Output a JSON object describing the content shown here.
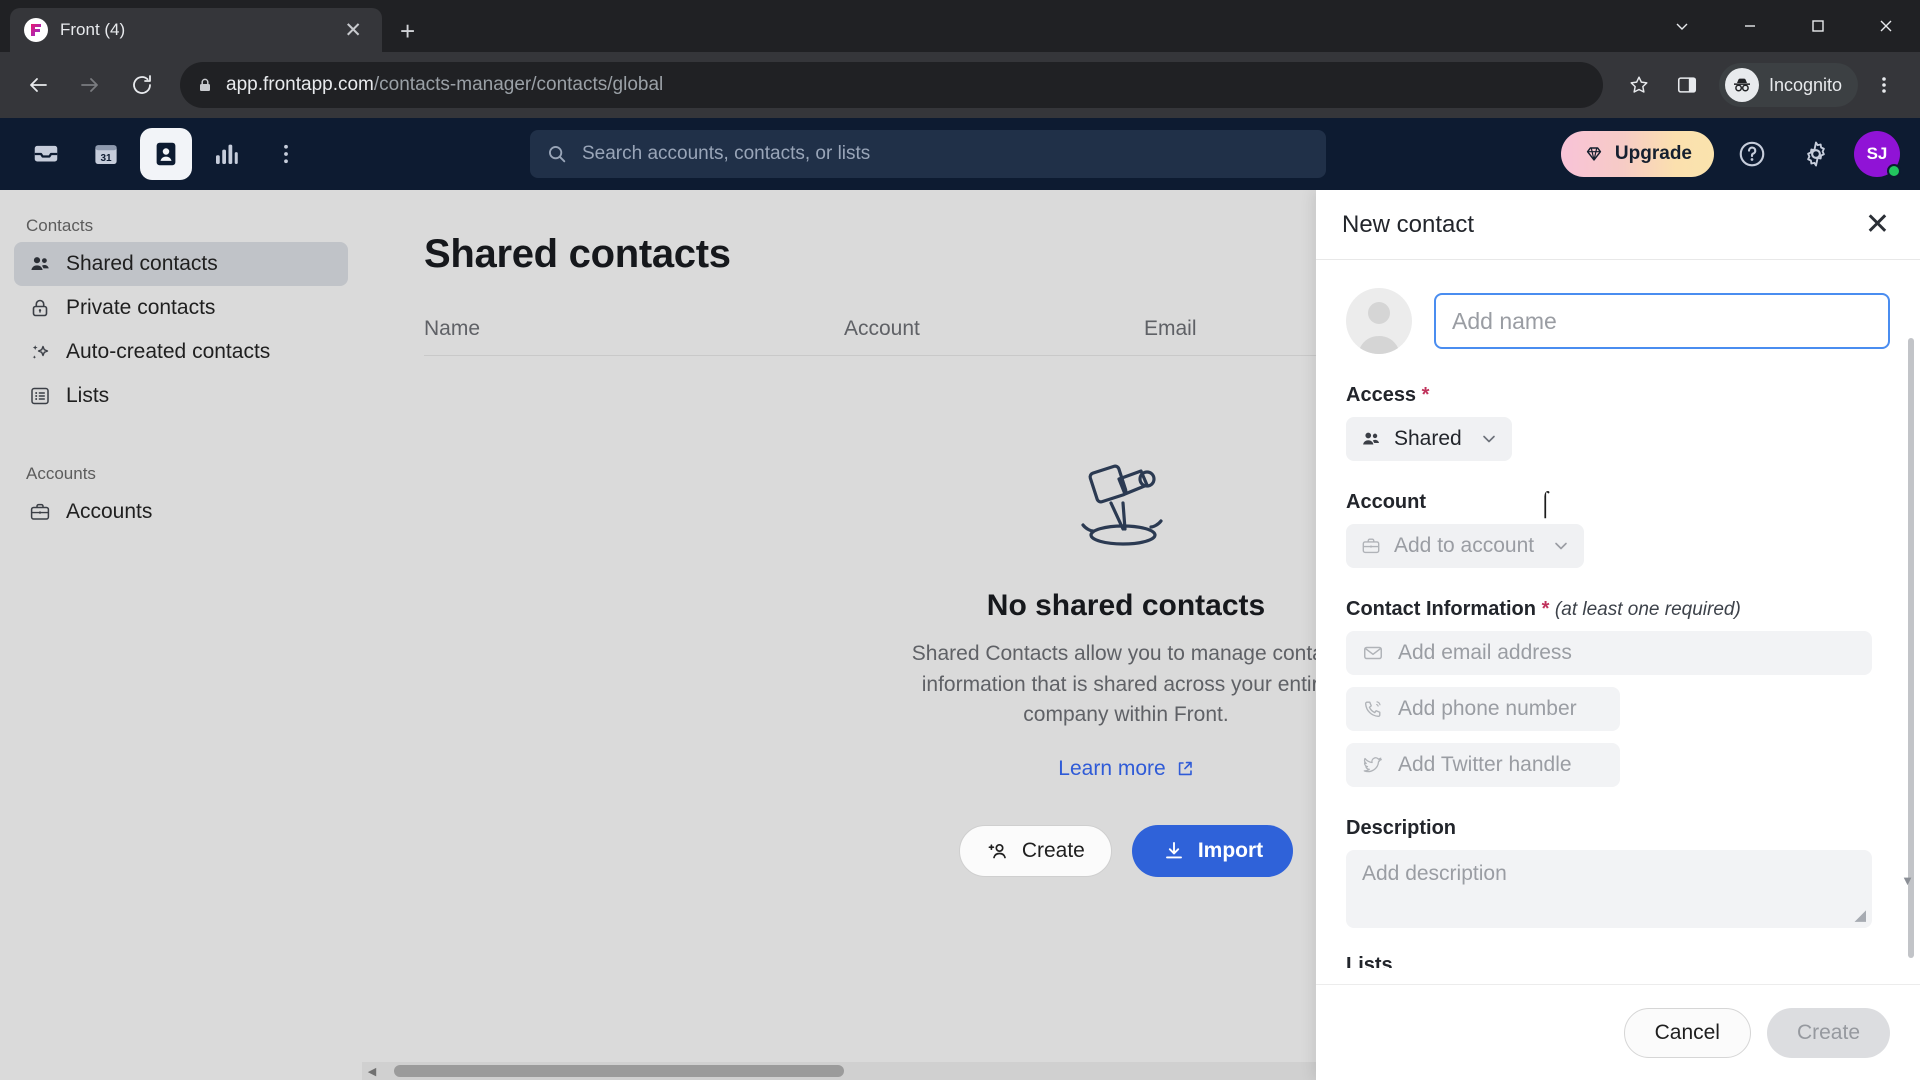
{
  "browser": {
    "tab": {
      "title": "Front (4)",
      "favicon_icon": "front-logo-icon",
      "close_icon": "close-icon"
    },
    "new_tab_label": "+",
    "window_controls": {
      "minimize": "–",
      "maximize": "□",
      "close": "✕",
      "chevron": "⌄"
    },
    "back_icon": "back-arrow-icon",
    "forward_icon": "forward-arrow-icon",
    "reload_icon": "reload-icon",
    "lock_icon": "lock-icon",
    "url_domain": "app.frontapp.com",
    "url_path": "/contacts-manager/contacts/global",
    "bookmark_icon": "star-icon",
    "sidepanel_icon": "side-panel-icon",
    "incognito_label": "Incognito",
    "menu_icon": "three-dot-menu-icon"
  },
  "app_topbar": {
    "nav": [
      {
        "name": "inbox",
        "icon": "inbox-icon",
        "active": false
      },
      {
        "name": "calendar",
        "icon": "calendar-31-icon",
        "active": false
      },
      {
        "name": "contacts",
        "icon": "contact-card-icon",
        "active": true
      },
      {
        "name": "analytics",
        "icon": "bar-chart-icon",
        "active": false
      },
      {
        "name": "more",
        "icon": "three-dot-vertical-icon",
        "active": false
      }
    ],
    "search_placeholder": "Search accounts, contacts, or lists",
    "search_icon": "search-icon",
    "upgrade_label": "Upgrade",
    "upgrade_icon": "diamond-icon",
    "help_icon": "question-circle-icon",
    "settings_icon": "gear-icon",
    "avatar_initials": "SJ"
  },
  "sidebar": {
    "groups": [
      {
        "label": "Contacts",
        "items": [
          {
            "label": "Shared contacts",
            "icon": "people-icon",
            "active": true
          },
          {
            "label": "Private contacts",
            "icon": "lock-icon",
            "active": false
          },
          {
            "label": "Auto-created contacts",
            "icon": "sparkle-icon",
            "active": false
          },
          {
            "label": "Lists",
            "icon": "list-icon",
            "active": false
          }
        ]
      },
      {
        "label": "Accounts",
        "items": [
          {
            "label": "Accounts",
            "icon": "briefcase-icon",
            "active": false
          }
        ]
      }
    ]
  },
  "main": {
    "page_title": "Shared contacts",
    "columns": [
      "Name",
      "Account",
      "Email"
    ],
    "empty_state": {
      "illustration": "telescope-icon",
      "title": "No shared contacts",
      "description": "Shared Contacts allow you to manage contact information that is shared across your entire company within Front.",
      "learn_more_label": "Learn more",
      "learn_more_icon": "external-link-icon",
      "create_label": "Create",
      "create_icon": "add-person-icon",
      "import_label": "Import",
      "import_icon": "download-icon"
    }
  },
  "panel": {
    "title": "New contact",
    "close_icon": "close-icon",
    "avatar_icon": "person-placeholder-icon",
    "name_field": {
      "value": "",
      "placeholder": "Add name"
    },
    "access": {
      "label": "Access",
      "required_mark": "*",
      "selected": "Shared",
      "icon": "people-icon",
      "chevron_icon": "chevron-down-icon"
    },
    "account": {
      "label": "Account",
      "placeholder": "Add to account",
      "icon": "briefcase-icon",
      "chevron_icon": "chevron-down-icon"
    },
    "contact_information": {
      "label": "Contact Information",
      "required_mark": "*",
      "hint": "(at least one required)",
      "fields": [
        {
          "name": "email",
          "placeholder": "Add email address",
          "icon": "envelope-icon"
        },
        {
          "name": "phone",
          "placeholder": "Add phone number",
          "icon": "phone-icon"
        },
        {
          "name": "twitter",
          "placeholder": "Add Twitter handle",
          "icon": "twitter-bird-icon"
        }
      ]
    },
    "description": {
      "label": "Description",
      "placeholder": "Add description"
    },
    "lists_label": "Lists",
    "footer": {
      "cancel_label": "Cancel",
      "create_label": "Create"
    }
  }
}
